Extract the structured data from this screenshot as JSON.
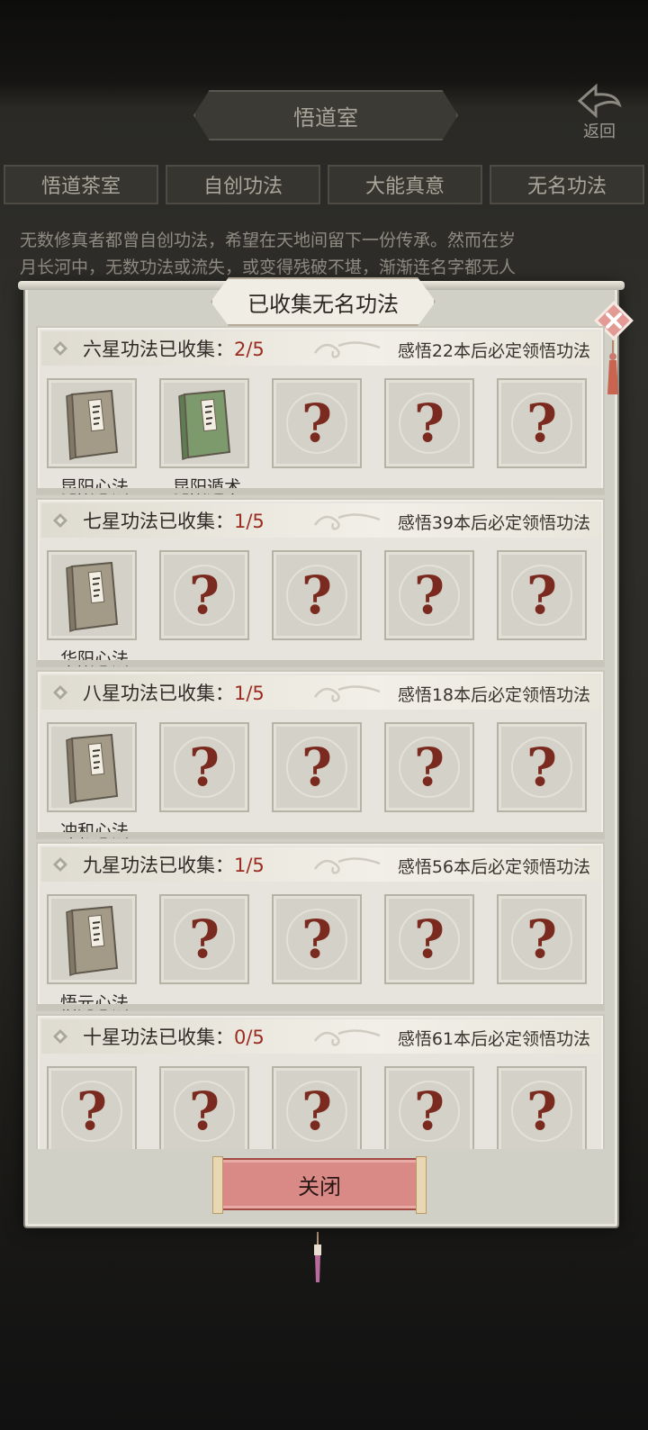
{
  "background": {
    "room_title": "悟道室",
    "back_label": "返回",
    "tabs": [
      "悟道茶室",
      "自创功法",
      "大能真意",
      "无名功法"
    ],
    "description_line1": "无数修真者都曾自创功法，希望在天地间留下一份传承。然而在岁",
    "description_line2": "月长河中，无数功法或流失，或变得残破不堪，渐渐连名字都无人"
  },
  "modal": {
    "title": "已收集无名功法",
    "close_button": "关闭",
    "sections": [
      {
        "label": "六星功法已收集：",
        "count": "2/5",
        "hint": "感悟22本后必定领悟功法",
        "slots": [
          {
            "type": "book",
            "color": "grey",
            "name": "昆阳心法"
          },
          {
            "type": "book",
            "color": "green",
            "name": "昆阳遁术"
          },
          {
            "type": "unknown"
          },
          {
            "type": "unknown"
          },
          {
            "type": "unknown"
          }
        ]
      },
      {
        "label": "七星功法已收集：",
        "count": "1/5",
        "hint": "感悟39本后必定领悟功法",
        "slots": [
          {
            "type": "book",
            "color": "grey",
            "name": "华阳心法"
          },
          {
            "type": "unknown"
          },
          {
            "type": "unknown"
          },
          {
            "type": "unknown"
          },
          {
            "type": "unknown"
          }
        ]
      },
      {
        "label": "八星功法已收集：",
        "count": "1/5",
        "hint": "感悟18本后必定领悟功法",
        "slots": [
          {
            "type": "book",
            "color": "grey",
            "name": "冲和心法"
          },
          {
            "type": "unknown"
          },
          {
            "type": "unknown"
          },
          {
            "type": "unknown"
          },
          {
            "type": "unknown"
          }
        ]
      },
      {
        "label": "九星功法已收集：",
        "count": "1/5",
        "hint": "感悟56本后必定领悟功法",
        "slots": [
          {
            "type": "book",
            "color": "grey",
            "name": "悟元心法"
          },
          {
            "type": "unknown"
          },
          {
            "type": "unknown"
          },
          {
            "type": "unknown"
          },
          {
            "type": "unknown"
          }
        ]
      },
      {
        "label": "十星功法已收集：",
        "count": "0/5",
        "hint": "感悟61本后必定领悟功法",
        "slots": [
          {
            "type": "unknown"
          },
          {
            "type": "unknown"
          },
          {
            "type": "unknown"
          },
          {
            "type": "unknown"
          },
          {
            "type": "unknown"
          }
        ]
      }
    ],
    "unknown_glyph": "?"
  },
  "colors": {
    "count_red": "#9a2c20",
    "book_grey": "#a39a88",
    "book_green": "#7d9a6c",
    "close_button": "#d98a86"
  }
}
